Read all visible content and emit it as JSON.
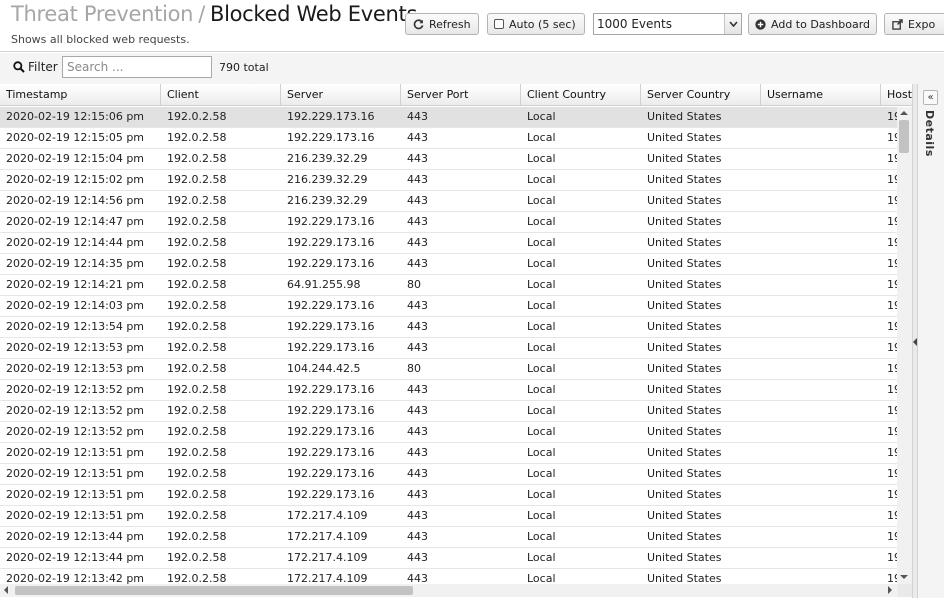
{
  "header": {
    "breadcrumb_parent": "Threat Prevention",
    "separator": "/",
    "page_title": "Blocked Web Events",
    "subtitle": "Shows all blocked web requests."
  },
  "toolbar": {
    "refresh_label": "Refresh",
    "auto_label": "Auto (5 sec)",
    "events_select": "1000 Events",
    "add_dashboard_label": "Add to Dashboard",
    "export_label": "Expo"
  },
  "filter": {
    "label": "Filter",
    "placeholder": "Search ...",
    "value": "",
    "total": "790 total"
  },
  "table": {
    "columns": [
      "Timestamp",
      "Client",
      "Server",
      "Server Port",
      "Client Country",
      "Server Country",
      "Username",
      "Host"
    ],
    "rows": [
      [
        "2020-02-19 12:15:06 pm",
        "192.0.2.58",
        "192.229.173.16",
        "443",
        "Local",
        "United States",
        "",
        "19"
      ],
      [
        "2020-02-19 12:15:05 pm",
        "192.0.2.58",
        "192.229.173.16",
        "443",
        "Local",
        "United States",
        "",
        "19"
      ],
      [
        "2020-02-19 12:15:04 pm",
        "192.0.2.58",
        "216.239.32.29",
        "443",
        "Local",
        "United States",
        "",
        "19"
      ],
      [
        "2020-02-19 12:15:02 pm",
        "192.0.2.58",
        "216.239.32.29",
        "443",
        "Local",
        "United States",
        "",
        "19"
      ],
      [
        "2020-02-19 12:14:56 pm",
        "192.0.2.58",
        "216.239.32.29",
        "443",
        "Local",
        "United States",
        "",
        "19"
      ],
      [
        "2020-02-19 12:14:47 pm",
        "192.0.2.58",
        "192.229.173.16",
        "443",
        "Local",
        "United States",
        "",
        "19"
      ],
      [
        "2020-02-19 12:14:44 pm",
        "192.0.2.58",
        "192.229.173.16",
        "443",
        "Local",
        "United States",
        "",
        "19"
      ],
      [
        "2020-02-19 12:14:35 pm",
        "192.0.2.58",
        "192.229.173.16",
        "443",
        "Local",
        "United States",
        "",
        "19"
      ],
      [
        "2020-02-19 12:14:21 pm",
        "192.0.2.58",
        "64.91.255.98",
        "80",
        "Local",
        "United States",
        "",
        "19"
      ],
      [
        "2020-02-19 12:14:03 pm",
        "192.0.2.58",
        "192.229.173.16",
        "443",
        "Local",
        "United States",
        "",
        "19"
      ],
      [
        "2020-02-19 12:13:54 pm",
        "192.0.2.58",
        "192.229.173.16",
        "443",
        "Local",
        "United States",
        "",
        "19"
      ],
      [
        "2020-02-19 12:13:53 pm",
        "192.0.2.58",
        "192.229.173.16",
        "443",
        "Local",
        "United States",
        "",
        "19"
      ],
      [
        "2020-02-19 12:13:53 pm",
        "192.0.2.58",
        "104.244.42.5",
        "80",
        "Local",
        "United States",
        "",
        "19"
      ],
      [
        "2020-02-19 12:13:52 pm",
        "192.0.2.58",
        "192.229.173.16",
        "443",
        "Local",
        "United States",
        "",
        "19"
      ],
      [
        "2020-02-19 12:13:52 pm",
        "192.0.2.58",
        "192.229.173.16",
        "443",
        "Local",
        "United States",
        "",
        "19"
      ],
      [
        "2020-02-19 12:13:52 pm",
        "192.0.2.58",
        "192.229.173.16",
        "443",
        "Local",
        "United States",
        "",
        "19"
      ],
      [
        "2020-02-19 12:13:51 pm",
        "192.0.2.58",
        "192.229.173.16",
        "443",
        "Local",
        "United States",
        "",
        "19"
      ],
      [
        "2020-02-19 12:13:51 pm",
        "192.0.2.58",
        "192.229.173.16",
        "443",
        "Local",
        "United States",
        "",
        "19"
      ],
      [
        "2020-02-19 12:13:51 pm",
        "192.0.2.58",
        "192.229.173.16",
        "443",
        "Local",
        "United States",
        "",
        "19"
      ],
      [
        "2020-02-19 12:13:51 pm",
        "192.0.2.58",
        "172.217.4.109",
        "443",
        "Local",
        "United States",
        "",
        "19"
      ],
      [
        "2020-02-19 12:13:44 pm",
        "192.0.2.58",
        "172.217.4.109",
        "443",
        "Local",
        "United States",
        "",
        "19"
      ],
      [
        "2020-02-19 12:13:44 pm",
        "192.0.2.58",
        "172.217.4.109",
        "443",
        "Local",
        "United States",
        "",
        "19"
      ],
      [
        "2020-02-19 12:13:42 pm",
        "192.0.2.58",
        "172.217.4.109",
        "443",
        "Local",
        "United States",
        "",
        "19"
      ]
    ]
  },
  "details_panel": {
    "label": "Details",
    "collapse_glyph": "«"
  }
}
